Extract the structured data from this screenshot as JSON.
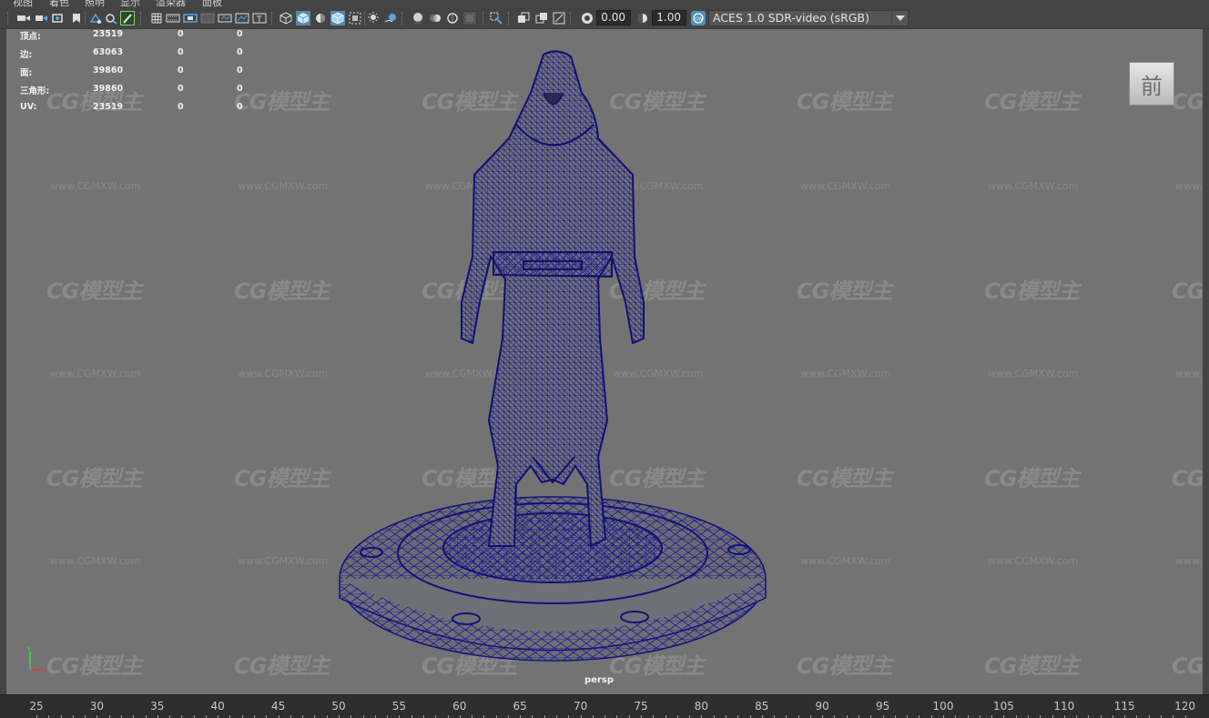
{
  "menubar": {
    "items": [
      "视图",
      "着色",
      "照明",
      "显示",
      "渲染器",
      "面板"
    ]
  },
  "toolbar": {
    "exposure_value": "0.00",
    "gamma_value": "1.00",
    "color_space": "ACES 1.0 SDR-video (sRGB)",
    "icons": [
      "camera-select-icon",
      "camera-attributes-icon",
      "bookmark-icon",
      "image-plane-icon",
      "2d-pan-zoom-icon",
      "grease-pencil-icon",
      "grid-icon",
      "film-gate-icon",
      "resolution-gate-icon",
      "gate-mask-icon",
      "field-chart-icon",
      "safe-action-icon",
      "safe-title-icon",
      "wireframe-icon",
      "smooth-shade-icon",
      "use-default-material-icon",
      "wireframe-on-shaded-icon",
      "xray-icon",
      "default-lighting-icon",
      "shadows-icon",
      "screen-space-ao-icon",
      "motion-blur-icon",
      "multisample-aa-icon",
      "depth-of-field-icon",
      "isolate-select-icon",
      "xray-joints-icon",
      "xray-active-icon",
      "frame-all-icon",
      "exposure-icon",
      "gamma-icon",
      "color-management-icon"
    ]
  },
  "hud": {
    "rows": [
      {
        "label": "顶点:",
        "total": "23519",
        "selected": "0",
        "third": "0"
      },
      {
        "label": "边:",
        "total": "63063",
        "selected": "0",
        "third": "0"
      },
      {
        "label": "面:",
        "total": "39860",
        "selected": "0",
        "third": "0"
      },
      {
        "label": "三角形:",
        "total": "39860",
        "selected": "0",
        "third": "0"
      },
      {
        "label": "UV:",
        "total": "23519",
        "selected": "0",
        "third": "0"
      }
    ]
  },
  "viewport": {
    "camera": "persp",
    "viewcube_label": "前",
    "watermark_logo": "CG模型主",
    "watermark_url": "www.CGMXW.com",
    "background_color": "#737373",
    "wireframe_color": "#10107a"
  },
  "timeline": {
    "ticks": [
      "25",
      "30",
      "35",
      "40",
      "45",
      "50",
      "55",
      "60",
      "65",
      "70",
      "75",
      "80",
      "85",
      "90",
      "95",
      "100",
      "105",
      "110",
      "115",
      "120"
    ]
  }
}
